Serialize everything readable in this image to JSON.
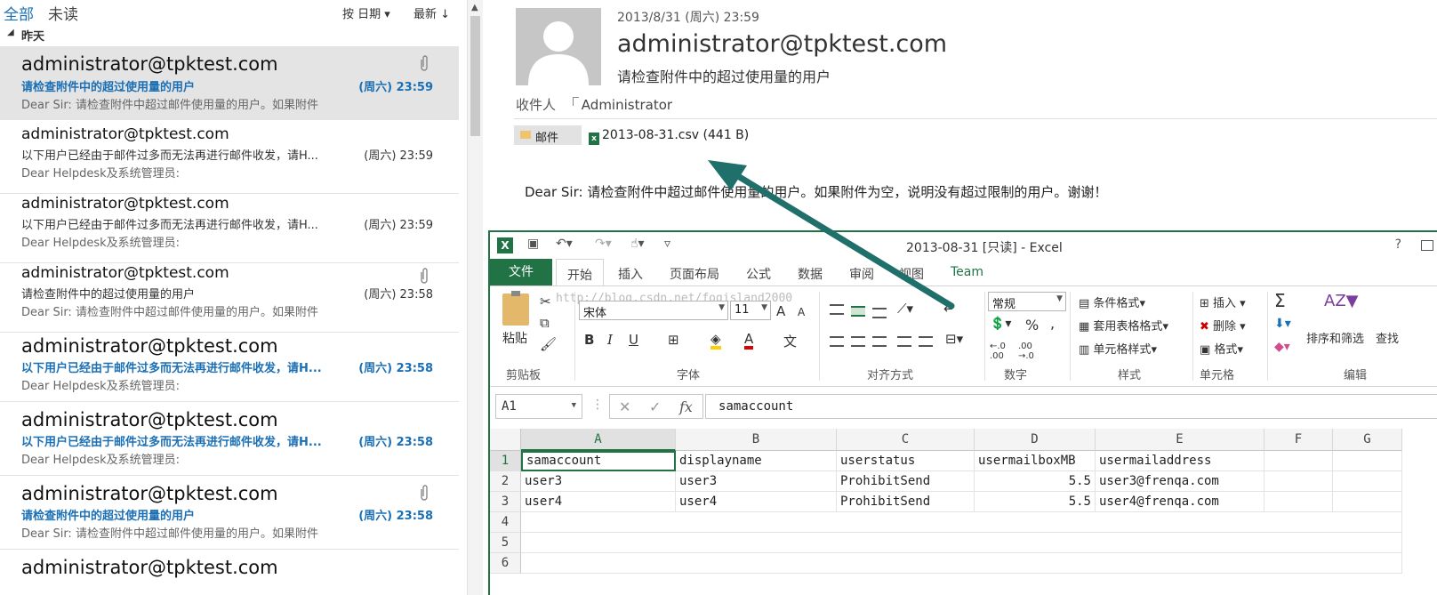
{
  "list": {
    "tab_all": "全部",
    "tab_unread": "未读",
    "sort_by": "按 日期 ▾",
    "sort_order": "最新 ↓",
    "group_label": "昨天",
    "items": [
      {
        "from": "administrator@tpktest.com",
        "subject": "请检查附件中的超过使用量的用户",
        "time": "(周六) 23:59",
        "preview": "Dear Sir: 请检查附件中超过邮件使用量的用户。如果附件"
      },
      {
        "from": "administrator@tpktest.com",
        "subject": "以下用户已经由于邮件过多而无法再进行邮件收发，请H...",
        "time": "(周六) 23:59",
        "preview": "Dear Helpdesk及系统管理员:"
      },
      {
        "from": "administrator@tpktest.com",
        "subject": "以下用户已经由于邮件过多而无法再进行邮件收发，请H...",
        "time": "(周六) 23:59",
        "preview": "Dear Helpdesk及系统管理员:"
      },
      {
        "from": "administrator@tpktest.com",
        "subject": "请检查附件中的超过使用量的用户",
        "time": "(周六) 23:58",
        "preview": "Dear Sir: 请检查附件中超过邮件使用量的用户。如果附件"
      },
      {
        "from": "administrator@tpktest.com",
        "subject": "以下用户已经由于邮件过多而无法再进行邮件收发，请H...",
        "time": "(周六) 23:58",
        "preview": "Dear Helpdesk及系统管理员:"
      },
      {
        "from": "administrator@tpktest.com",
        "subject": "以下用户已经由于邮件过多而无法再进行邮件收发，请H...",
        "time": "(周六) 23:58",
        "preview": "Dear Helpdesk及系统管理员:"
      },
      {
        "from": "administrator@tpktest.com",
        "subject": "请检查附件中的超过使用量的用户",
        "time": "(周六) 23:58",
        "preview": "Dear Sir: 请检查附件中超过邮件使用量的用户。如果附件"
      },
      {
        "from": "administrator@tpktest.com",
        "subject": "",
        "time": "",
        "preview": ""
      }
    ]
  },
  "reading": {
    "date": "2013/8/31 (周六) 23:59",
    "from": "administrator@tpktest.com",
    "subject": "请检查附件中的超过使用量的用户",
    "to_label": "收件人",
    "to_name": "Administrator",
    "mail_chip": "邮件",
    "attachment": "2013-08-31.csv (441 B)",
    "body": "Dear Sir:  请检查附件中超过邮件使用量的用户。如果附件为空，说明没有超过限制的用户。谢谢！"
  },
  "excel": {
    "title": "2013-08-31  [只读] - Excel",
    "help": "?",
    "tabs": {
      "file": "文件",
      "home": "开始",
      "insert": "插入",
      "layout": "页面布局",
      "formula": "公式",
      "data": "数据",
      "review": "审阅",
      "view": "视图",
      "team": "Team"
    },
    "ribbon": {
      "paste": "粘贴",
      "clipboard": "剪贴板",
      "font_name": "宋体",
      "font_size": "11",
      "font_group": "字体",
      "align_group": "对齐方式",
      "number_format": "常规",
      "number_group": "数字",
      "cond_format": "条件格式",
      "table_format": "套用表格格式",
      "cell_style": "单元格样式",
      "style_group": "样式",
      "insert": "插入",
      "delete": "删除",
      "format": "格式",
      "cells_group": "单元格",
      "sort_filter": "排序和筛选",
      "find": "查找",
      "edit_group": "编辑",
      "bold": "B",
      "italic": "I",
      "underline": "U",
      "grow": "A",
      "shrink": "A",
      "font_color": "A",
      "percent": "%",
      "comma": ",",
      "sigma": "Σ",
      "watermark": "http://blog.csdn.net/fogisland2000"
    },
    "name_box": "A1",
    "formula": "samaccount",
    "columns": [
      "A",
      "B",
      "C",
      "D",
      "E",
      "F",
      "G"
    ],
    "rows": [
      "1",
      "2",
      "3",
      "4",
      "5",
      "6"
    ],
    "cells": [
      [
        "samaccount",
        "displayname",
        "userstatus",
        "usermailboxMB",
        "usermailaddress"
      ],
      [
        "user3",
        "user3",
        "ProhibitSend",
        "5.5",
        "user3@frenqa.com"
      ],
      [
        "user4",
        "user4",
        "ProhibitSend",
        "5.5",
        "user4@frenqa.com"
      ]
    ]
  }
}
